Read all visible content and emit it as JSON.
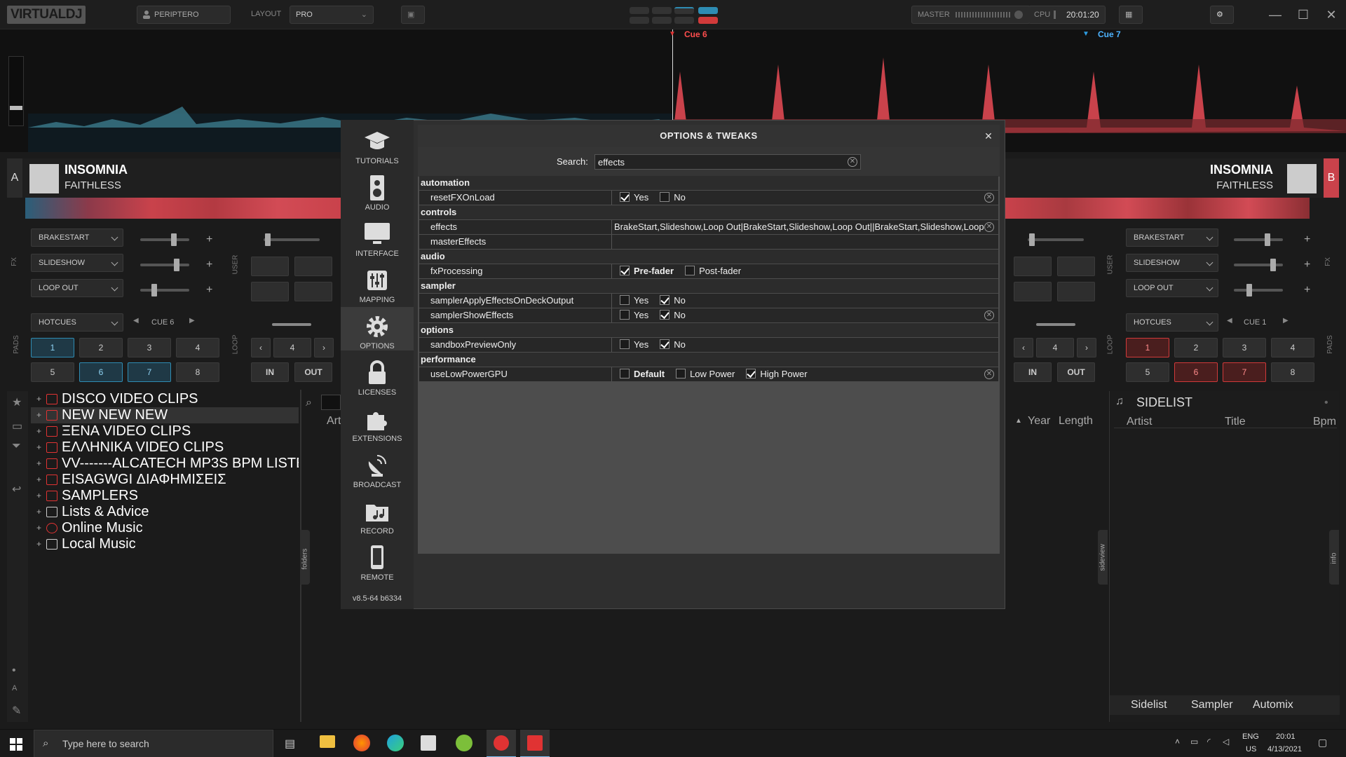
{
  "app": {
    "logo": "VIRTUALDJ",
    "profile": "PERIPTERO",
    "layout_label": "LAYOUT",
    "layout_value": "PRO",
    "master_label": "MASTER",
    "cpu_label": "CPU",
    "clock": "20:01:20"
  },
  "waveform": {
    "cue_left": "Cue 6",
    "cue_right": "Cue 7"
  },
  "deck_a": {
    "letter": "A",
    "title": "INSOMNIA",
    "artist": "FAITHLESS",
    "fx": [
      "BRAKESTART",
      "SLIDESHOW",
      "LOOP OUT"
    ],
    "fx_label": "FX",
    "user_label": "USER",
    "pads_label": "PADS",
    "loop_label": "LOOP",
    "pad_mode": "HOTCUES",
    "cue_sel": "CUE 6",
    "pads": [
      "1",
      "2",
      "3",
      "4",
      "5",
      "6",
      "7",
      "8"
    ],
    "loop_size": "4",
    "loop_in": "IN",
    "loop_out": "OUT"
  },
  "deck_b": {
    "letter": "B",
    "title": "INSOMNIA",
    "artist": "FAITHLESS",
    "fx": [
      "BRAKESTART",
      "SLIDESHOW",
      "LOOP OUT"
    ],
    "fx_label": "FX",
    "user_label": "USER",
    "pads_label": "PADS",
    "loop_label": "LOOP",
    "pad_mode": "HOTCUES",
    "cue_sel": "CUE 1",
    "pads": [
      "1",
      "2",
      "3",
      "4",
      "5",
      "6",
      "7",
      "8"
    ],
    "loop_size": "4",
    "loop_in": "IN",
    "loop_out": "OUT"
  },
  "browser": {
    "folders": [
      "DISCO VIDEO CLIPS",
      "NEW NEW NEW",
      "ΞΕΝΑ VIDEO CLIPS",
      "ΕΛΛΗΝΙΚΑ VIDEO CLIPS",
      "VV-------ALCATECH MP3S BPM LISTES------VV",
      "EISAGWGI ΔΙΑΦΗΜΙΣΕΙΣ",
      "SAMPLERS",
      "Lists & Advice",
      "Online Music",
      "Local Music"
    ],
    "folders_tab": "folders",
    "col_art": "Art",
    "col_year": "Year",
    "col_length": "Length",
    "sideview_tab": "sideview"
  },
  "sidelist": {
    "title": "SIDELIST",
    "cols": [
      "Artist",
      "Title",
      "Bpm"
    ],
    "info_tab": "info",
    "tabs": [
      "Sidelist",
      "Sampler",
      "Automix"
    ]
  },
  "dialog": {
    "title": "OPTIONS & TWEAKS",
    "search_label": "Search:",
    "search_value": "effects",
    "version": "v8.5-64 b6334",
    "nav": [
      "TUTORIALS",
      "AUDIO",
      "INTERFACE",
      "MAPPING",
      "OPTIONS",
      "LICENSES",
      "EXTENSIONS",
      "BROADCAST",
      "RECORD",
      "REMOTE"
    ],
    "groups": {
      "automation": "automation",
      "controls": "controls",
      "audio": "audio",
      "sampler": "sampler",
      "options": "options",
      "performance": "performance"
    },
    "rows": {
      "resetFXOnLoad": {
        "name": "resetFXOnLoad",
        "opt1": "Yes",
        "opt2": "No"
      },
      "effects": {
        "name": "effects",
        "value": "BrakeStart,Slideshow,Loop Out|BrakeStart,Slideshow,Loop Out||BrakeStart,Slideshow,Loop"
      },
      "masterEffects": {
        "name": "masterEffects"
      },
      "fxProcessing": {
        "name": "fxProcessing",
        "opt1": "Pre-fader",
        "opt2": "Post-fader"
      },
      "samplerApply": {
        "name": "samplerApplyEffectsOnDeckOutput",
        "opt1": "Yes",
        "opt2": "No"
      },
      "samplerShow": {
        "name": "samplerShowEffects",
        "opt1": "Yes",
        "opt2": "No"
      },
      "sandbox": {
        "name": "sandboxPreviewOnly",
        "opt1": "Yes",
        "opt2": "No"
      },
      "lowPower": {
        "name": "useLowPowerGPU",
        "opt1": "Default",
        "opt2": "Low Power",
        "opt3": "High Power"
      }
    }
  },
  "taskbar": {
    "search_placeholder": "Type here to search",
    "lang1": "ENG",
    "lang2": "US",
    "time": "20:01",
    "date": "4/13/2021"
  },
  "colors": {
    "accent_blue": "#2e8cb3",
    "accent_red": "#d13a3a",
    "panel": "#4d4d4d"
  }
}
